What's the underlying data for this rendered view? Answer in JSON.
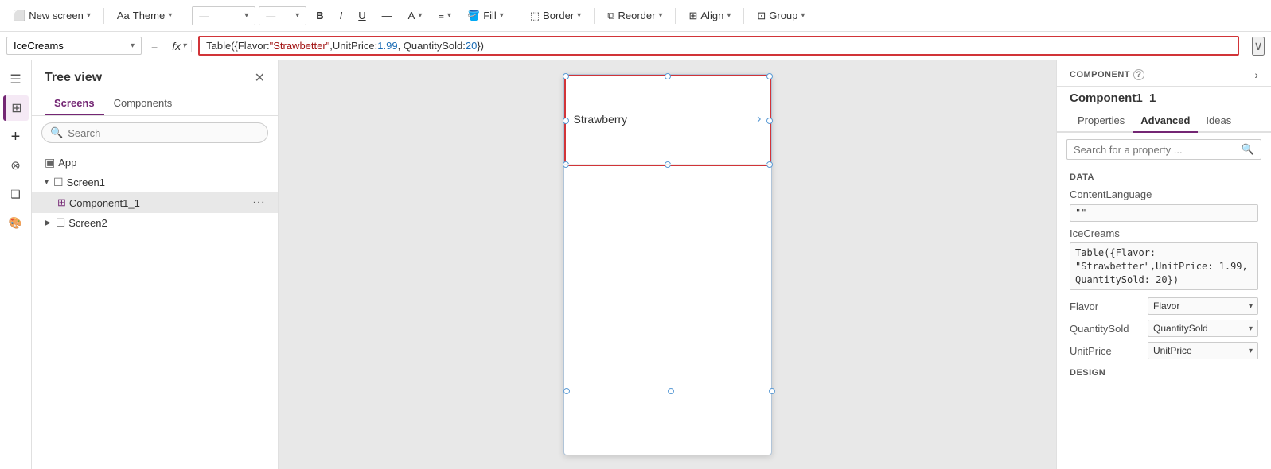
{
  "toolbar": {
    "new_screen_label": "New screen",
    "theme_label": "Theme",
    "bold_label": "B",
    "italic_label": "I",
    "underline_label": "U",
    "align_label": "A",
    "fill_label": "Fill",
    "border_label": "Border",
    "reorder_label": "Reorder",
    "align2_label": "Align",
    "group_label": "Group"
  },
  "formula_bar": {
    "name_box": "IceCreams",
    "fx_label": "fx",
    "formula": "Table({Flavor: \"Strawbetter\",UnitPrice: 1.99, QuantitySold: 20})",
    "formula_plain_before": "Table({Flavor: ",
    "formula_string": "\"Strawbetter\"",
    "formula_plain_mid": ",UnitPrice: ",
    "formula_number1": "1.99",
    "formula_plain_mid2": ", QuantitySold: ",
    "formula_number2": "20",
    "formula_plain_end": "})"
  },
  "tree": {
    "title": "Tree view",
    "tabs": [
      "Screens",
      "Components"
    ],
    "search_placeholder": "Search",
    "items": [
      {
        "label": "App",
        "icon": "app",
        "indent": 0,
        "expanded": false
      },
      {
        "label": "Screen1",
        "icon": "screen",
        "indent": 0,
        "expanded": true
      },
      {
        "label": "Component1_1",
        "icon": "component",
        "indent": 1,
        "selected": true,
        "has_more": true
      },
      {
        "label": "Screen2",
        "icon": "screen",
        "indent": 0,
        "expanded": false
      }
    ]
  },
  "canvas": {
    "item_text": "Strawberry"
  },
  "right_panel": {
    "component_label": "COMPONENT",
    "component_name": "Component1_1",
    "tabs": [
      "Properties",
      "Advanced",
      "Ideas"
    ],
    "active_tab": "Advanced",
    "search_placeholder": "Search for a property ...",
    "sections": {
      "data": {
        "label": "DATA",
        "content_language_label": "ContentLanguage",
        "content_language_value": "\"\"",
        "ice_creams_label": "IceCreams",
        "ice_creams_value": "Table({Flavor:\n\"Strawbetter\",UnitPrice: 1.99,\nQuantitySold: 20})",
        "flavor_label": "Flavor",
        "flavor_value": "Flavor",
        "quantity_label": "QuantitySold",
        "quantity_value": "QuantitySold",
        "unit_price_label": "UnitPrice",
        "unit_price_value": "UnitPrice"
      },
      "design": {
        "label": "DESIGN"
      }
    }
  },
  "left_icons": {
    "icons": [
      {
        "name": "hamburger-icon",
        "symbol": "☰"
      },
      {
        "name": "layers-icon",
        "symbol": "⊞"
      },
      {
        "name": "add-icon",
        "symbol": "+"
      },
      {
        "name": "data-icon",
        "symbol": "⊗"
      },
      {
        "name": "components-icon",
        "symbol": "❑"
      },
      {
        "name": "theme-icon",
        "symbol": "🎨"
      }
    ]
  }
}
